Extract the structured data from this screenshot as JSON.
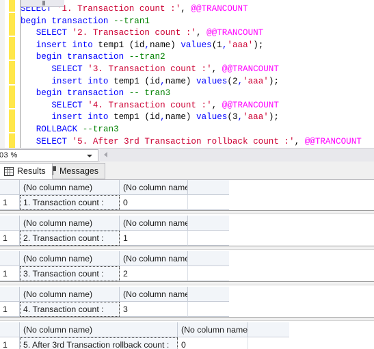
{
  "editor": {
    "zoom_level": "03 %",
    "lines": [
      [
        {
          "t": "kw",
          "s": "SELECT "
        },
        {
          "t": "str",
          "s": "'1. Transaction count :'"
        },
        {
          "t": "pln",
          "s": ", "
        },
        {
          "t": "var",
          "s": "@@TRANCOUNT"
        }
      ],
      [
        {
          "t": "kw",
          "s": "begin transaction "
        },
        {
          "t": "cmt",
          "s": "--tran1"
        }
      ],
      [
        {
          "t": "pln",
          "s": "   "
        },
        {
          "t": "kw",
          "s": "SELECT "
        },
        {
          "t": "str",
          "s": "'2. Transaction count :'"
        },
        {
          "t": "pln",
          "s": ", "
        },
        {
          "t": "var",
          "s": "@@TRANCOUNT"
        }
      ],
      [
        {
          "t": "pln",
          "s": "   "
        },
        {
          "t": "kw",
          "s": "insert into "
        },
        {
          "t": "pln",
          "s": "temp1 ("
        },
        {
          "t": "pln",
          "s": "id"
        },
        {
          "t": "kw",
          "s": ","
        },
        {
          "t": "pln",
          "s": "name"
        },
        {
          "t": "pln",
          "s": ") "
        },
        {
          "t": "kw",
          "s": "values"
        },
        {
          "t": "pln",
          "s": "("
        },
        {
          "t": "num",
          "s": "1"
        },
        {
          "t": "kw",
          "s": ","
        },
        {
          "t": "str",
          "s": "'aaa'"
        },
        {
          "t": "pln",
          "s": ");"
        }
      ],
      [
        {
          "t": "pln",
          "s": "   "
        },
        {
          "t": "kw",
          "s": "begin transaction "
        },
        {
          "t": "cmt",
          "s": "--tran2"
        }
      ],
      [
        {
          "t": "pln",
          "s": "      "
        },
        {
          "t": "kw",
          "s": "SELECT "
        },
        {
          "t": "str",
          "s": "'3. Transaction count :'"
        },
        {
          "t": "pln",
          "s": ", "
        },
        {
          "t": "var",
          "s": "@@TRANCOUNT"
        }
      ],
      [
        {
          "t": "pln",
          "s": "      "
        },
        {
          "t": "kw",
          "s": "insert into "
        },
        {
          "t": "pln",
          "s": "temp1 ("
        },
        {
          "t": "pln",
          "s": "id"
        },
        {
          "t": "kw",
          "s": ","
        },
        {
          "t": "pln",
          "s": "name"
        },
        {
          "t": "pln",
          "s": ") "
        },
        {
          "t": "kw",
          "s": "values"
        },
        {
          "t": "pln",
          "s": "("
        },
        {
          "t": "num",
          "s": "2"
        },
        {
          "t": "kw",
          "s": ","
        },
        {
          "t": "str",
          "s": "'aaa'"
        },
        {
          "t": "pln",
          "s": ");"
        }
      ],
      [
        {
          "t": "pln",
          "s": "   "
        },
        {
          "t": "kw",
          "s": "begin transaction "
        },
        {
          "t": "cmt",
          "s": "-- tran3"
        }
      ],
      [
        {
          "t": "pln",
          "s": "      "
        },
        {
          "t": "kw",
          "s": "SELECT "
        },
        {
          "t": "str",
          "s": "'4. Transaction count :'"
        },
        {
          "t": "pln",
          "s": ", "
        },
        {
          "t": "var",
          "s": "@@TRANCOUNT"
        }
      ],
      [
        {
          "t": "pln",
          "s": "      "
        },
        {
          "t": "kw",
          "s": "insert into "
        },
        {
          "t": "pln",
          "s": "temp1 ("
        },
        {
          "t": "pln",
          "s": "id"
        },
        {
          "t": "kw",
          "s": ","
        },
        {
          "t": "pln",
          "s": "name"
        },
        {
          "t": "pln",
          "s": ") "
        },
        {
          "t": "kw",
          "s": "values"
        },
        {
          "t": "pln",
          "s": "("
        },
        {
          "t": "num",
          "s": "3"
        },
        {
          "t": "kw",
          "s": ","
        },
        {
          "t": "str",
          "s": "'aaa'"
        },
        {
          "t": "pln",
          "s": ");"
        }
      ],
      [
        {
          "t": "pln",
          "s": "   "
        },
        {
          "t": "kw",
          "s": "ROLLBACK "
        },
        {
          "t": "cmt",
          "s": "--tran3"
        }
      ],
      [
        {
          "t": "pln",
          "s": "   "
        },
        {
          "t": "kw",
          "s": "SELECT "
        },
        {
          "t": "str",
          "s": "'5. After 3rd Transaction rollback count :'"
        },
        {
          "t": "pln",
          "s": ", "
        },
        {
          "t": "var",
          "s": "@@TRANCOUNT"
        }
      ]
    ]
  },
  "tabs": [
    {
      "label": "Results",
      "icon": "grid-icon",
      "active": true
    },
    {
      "label": "Messages",
      "icon": "document-icon",
      "active": false
    }
  ],
  "results": {
    "column_header_label": "(No column name)",
    "grids": [
      {
        "row_number": "1",
        "col1": "1. Transaction count :",
        "col2": "0",
        "col1_width": 146,
        "col2_width": 100
      },
      {
        "row_number": "1",
        "col1": "2. Transaction count :",
        "col2": "1",
        "col1_width": 146,
        "col2_width": 100
      },
      {
        "row_number": "1",
        "col1": "3. Transaction count :",
        "col2": "2",
        "col1_width": 146,
        "col2_width": 100
      },
      {
        "row_number": "1",
        "col1": "4. Transaction count :",
        "col2": "3",
        "col1_width": 146,
        "col2_width": 100
      },
      {
        "row_number": "1",
        "col1": "5. After 3rd Transaction rollback count :",
        "col2": "0",
        "col1_width": 231,
        "col2_width": 103
      }
    ]
  },
  "colors": {
    "keyword": "#0000ff",
    "string": "#cc0033",
    "variable": "#ff00ff",
    "comment": "#008000",
    "plain": "#000000",
    "change_track": "#ffe74a"
  }
}
